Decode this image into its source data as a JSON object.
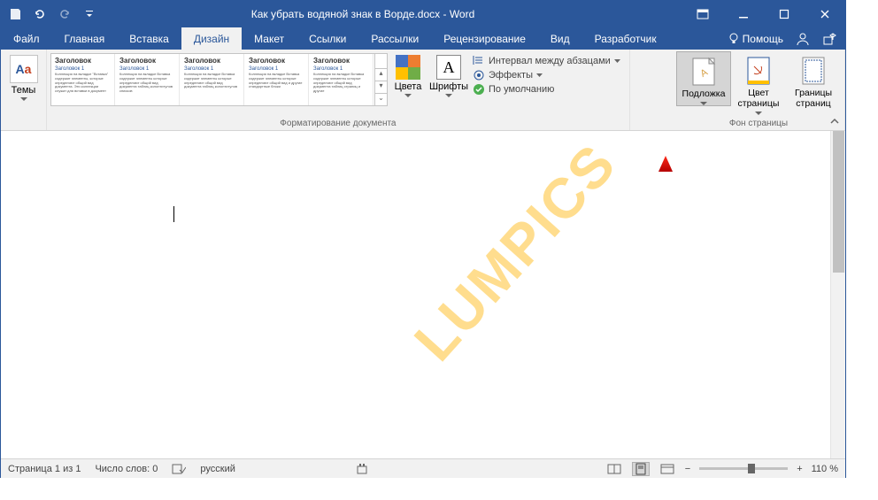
{
  "titlebar": {
    "title": "Как убрать водяной знак в Ворде.docx - Word"
  },
  "tabs": {
    "file": "Файл",
    "home": "Главная",
    "insert": "Вставка",
    "design": "Дизайн",
    "layout": "Макет",
    "references": "Ссылки",
    "mailings": "Рассылки",
    "review": "Рецензирование",
    "view": "Вид",
    "developer": "Разработчик",
    "help": "Помощь"
  },
  "ribbon": {
    "themes": "Темы",
    "doc_formatting_label": "Форматирование документа",
    "style_heading": "Заголовок",
    "style_sub": "Заголовок 1",
    "colors": "Цвета",
    "fonts": "Шрифты",
    "para_spacing": "Интервал между абзацами",
    "effects": "Эффекты",
    "set_default": "По умолчанию",
    "watermark": "Подложка",
    "page_color": "Цвет страницы",
    "page_borders": "Границы страниц",
    "page_bg_label": "Фон страницы"
  },
  "document": {
    "watermark_text": "LUMPICS"
  },
  "status": {
    "page": "Страница 1 из 1",
    "words": "Число слов: 0",
    "language": "русский",
    "zoom": "110 %"
  }
}
